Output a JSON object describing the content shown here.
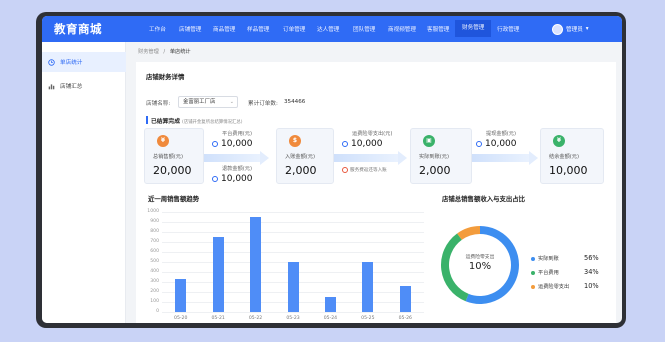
{
  "app": {
    "title": "教育商城"
  },
  "nav": {
    "items": [
      {
        "label": "工作台",
        "active": false
      },
      {
        "label": "店铺管理",
        "active": false
      },
      {
        "label": "商品管理",
        "active": false
      },
      {
        "label": "样品管理",
        "active": false
      },
      {
        "label": "订单管理",
        "active": false
      },
      {
        "label": "达人管理",
        "active": false
      },
      {
        "label": "团队管理",
        "active": false
      },
      {
        "label": "商视频管理",
        "active": false
      },
      {
        "label": "客服管理",
        "active": false
      },
      {
        "label": "财务管理",
        "active": true
      },
      {
        "label": "行政管理",
        "active": false
      }
    ],
    "user": "管理员"
  },
  "sidebar": {
    "items": [
      {
        "label": "单店统计",
        "icon": "clock-icon",
        "active": true
      },
      {
        "label": "店铺汇总",
        "icon": "chart-bars-icon",
        "active": false
      }
    ]
  },
  "breadcrumb": {
    "parent": "财务管理",
    "sep": "/",
    "current": "单店统计"
  },
  "detail": {
    "title": "店铺财务详情",
    "shop_label": "店铺名称:",
    "shop_value": "金富丽工厂店",
    "orders_label": "累计订单数:",
    "orders_value": "354466",
    "done_title": "已结算完成",
    "done_note": "(店铺开金复所总结算情况汇总)"
  },
  "flow": {
    "total_sales": {
      "label": "总销售额(元)",
      "value": "20,000",
      "color": "#f08a3c"
    },
    "platform_fee": {
      "label": "平台费用(元)",
      "value": "10,000"
    },
    "refund": {
      "label": "退款金额(元)",
      "value": "10,000"
    },
    "income": {
      "label": "入账金额(元)",
      "value": "2,000",
      "color": "#f08a3c"
    },
    "shipping": {
      "label": "运费险零支出(元)",
      "value": "10,000"
    },
    "service_note": "服务费返还等入账",
    "actual": {
      "label": "实际到账(元)",
      "value": "2,000",
      "color": "#3ab26a"
    },
    "withdrawn": {
      "label": "提现金额(元)",
      "value": "10,000"
    },
    "balance": {
      "label": "结余金额(元)",
      "value": "10,000",
      "color": "#3ab26a"
    }
  },
  "bar_section": {
    "title": "近一周销售额趋势"
  },
  "pie_section": {
    "title": "店铺总销售额收入与支出占比",
    "center_label": "运费险零支出",
    "center_value": "10%"
  },
  "chart_data": [
    {
      "type": "bar",
      "categories": [
        "05-20",
        "05-21",
        "05-22",
        "05-23",
        "05-24",
        "05-25",
        "05-26"
      ],
      "values": [
        330,
        750,
        950,
        500,
        150,
        500,
        260
      ],
      "yticks": [
        "0",
        "100",
        "200",
        "300",
        "400",
        "500",
        "600",
        "700",
        "800",
        "900",
        "1000"
      ],
      "ylim": [
        0,
        1000
      ],
      "color": "#4f8df7"
    },
    {
      "type": "pie",
      "labels": [
        "实际到账",
        "平台费用",
        "运费险零支出"
      ],
      "values": [
        56,
        34,
        10
      ],
      "display": [
        "56%",
        "34%",
        "10%"
      ],
      "colors": [
        "#3d8ef0",
        "#3ab26a",
        "#f39c3c"
      ]
    }
  ]
}
